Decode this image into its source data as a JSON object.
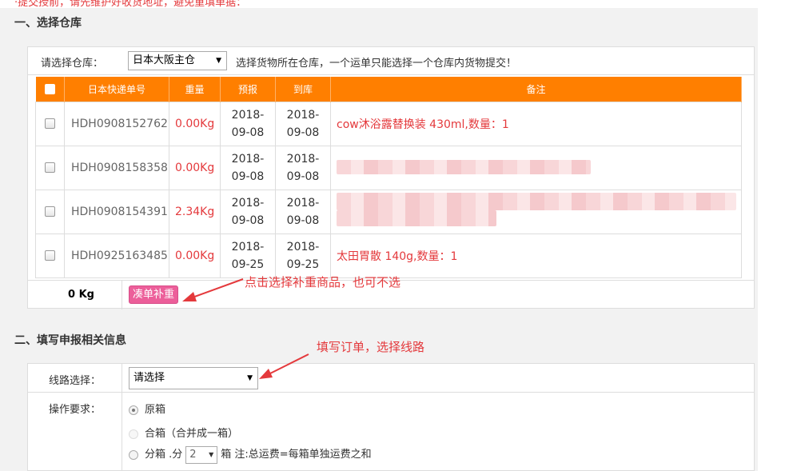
{
  "top_notice": "·提交授前，请先维护好收货地址，避免重填单据：",
  "section1": {
    "title": "一、选择仓库",
    "warehouse_label": "请选择仓库：",
    "warehouse_value": "日本大阪主仓",
    "warehouse_hint": "选择货物所在仓库，一个运单只能选择一个仓库内货物提交！",
    "columns": [
      "日本快递单号",
      "重量",
      "预报",
      "到库",
      "备注"
    ],
    "rows": [
      {
        "tracking": "HDH0908152762",
        "weight": "0.00Kg",
        "forecast": [
          "2018-",
          "09-08"
        ],
        "arrival": [
          "2018-",
          "09-08"
        ],
        "note": "cow沐浴露替换装 430ml,数量：1"
      },
      {
        "tracking": "HDH0908158358",
        "weight": "0.00Kg",
        "forecast": [
          "2018-",
          "09-08"
        ],
        "arrival": [
          "2018-",
          "09-08"
        ],
        "note": ""
      },
      {
        "tracking": "HDH0908154391",
        "weight": "2.34Kg",
        "forecast": [
          "2018-",
          "09-08"
        ],
        "arrival": [
          "2018-",
          "09-08"
        ],
        "note": ""
      },
      {
        "tracking": "HDH0925163485",
        "weight": "0.00Kg",
        "forecast": [
          "2018-",
          "09-25"
        ],
        "arrival": [
          "2018-",
          "09-25"
        ],
        "note": "太田胃散 140g,数量：1"
      }
    ],
    "total_weight": "0 Kg",
    "supplement_button": "凑单补重",
    "annotation": "点击选择补重商品，也可不选"
  },
  "section2": {
    "title": "二、填写申报相关信息",
    "annotation": "填写订单，选择线路",
    "route_label": "线路选择：",
    "route_value": "请选择",
    "op_label": "操作要求：",
    "options": {
      "original": "原箱",
      "combine": "合箱（合并成一箱）",
      "split_prefix": "分箱 .分",
      "split_count": "2",
      "split_suffix": "箱 注:总运费=每箱单独运费之和"
    }
  },
  "colors": {
    "accent": "#ff7f00",
    "alert": "#e4393c",
    "button": "#ec5f9a"
  }
}
